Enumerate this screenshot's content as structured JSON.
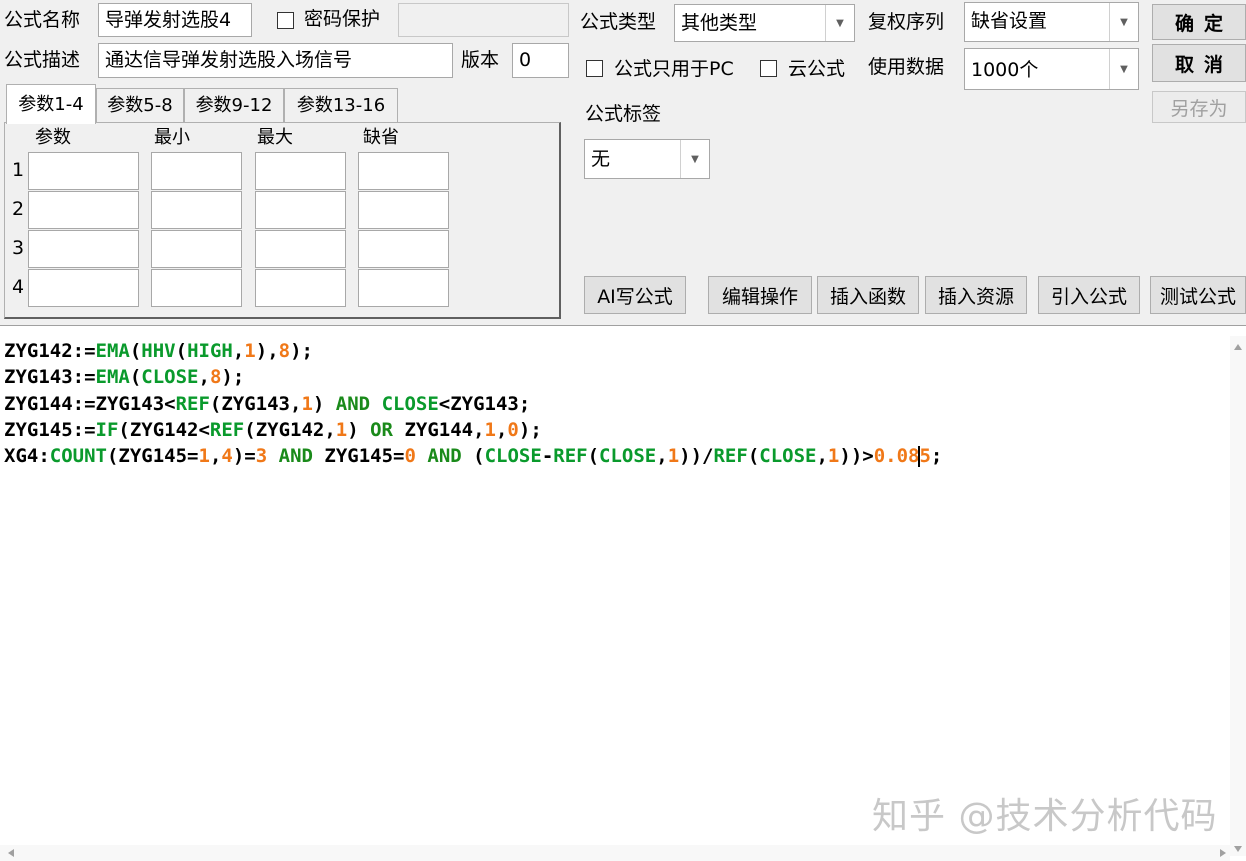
{
  "header": {
    "name_label": "公式名称",
    "name_value": "导弹发射选股4",
    "password_label": "密码保护",
    "password_value": "",
    "desc_label": "公式描述",
    "desc_value": "通达信导弹发射选股入场信号",
    "version_label": "版本",
    "version_value": "0",
    "type_label": "公式类型",
    "type_value": "其他类型",
    "rights_label": "复权序列",
    "rights_value": "缺省设置",
    "pc_only_label": "公式只用于PC",
    "cloud_label": "云公式",
    "data_label": "使用数据",
    "data_value": "1000个",
    "tag_label": "公式标签",
    "tag_value": "无"
  },
  "buttons": {
    "ok": "确定",
    "cancel": "取消",
    "save_as": "另存为",
    "ai": "AI写公式",
    "edit": "编辑操作",
    "insert_func": "插入函数",
    "insert_res": "插入资源",
    "import": "引入公式",
    "test": "测试公式"
  },
  "params": {
    "tabs": [
      "参数1-4",
      "参数5-8",
      "参数9-12",
      "参数13-16"
    ],
    "active_tab": 0,
    "columns": [
      "参数",
      "最小",
      "最大",
      "缺省"
    ],
    "rows": [
      "1",
      "2",
      "3",
      "4"
    ]
  },
  "editor": {
    "lines": [
      [
        {
          "t": "ZYG142:=",
          "c": ""
        },
        {
          "t": "EMA",
          "c": "fn"
        },
        {
          "t": "(",
          "c": ""
        },
        {
          "t": "HHV",
          "c": "fn"
        },
        {
          "t": "(",
          "c": ""
        },
        {
          "t": "HIGH",
          "c": "fn"
        },
        {
          "t": ",",
          "c": ""
        },
        {
          "t": "1",
          "c": "num"
        },
        {
          "t": "),",
          "c": ""
        },
        {
          "t": "8",
          "c": "num"
        },
        {
          "t": ");",
          "c": ""
        }
      ],
      [
        {
          "t": "ZYG143:=",
          "c": ""
        },
        {
          "t": "EMA",
          "c": "fn"
        },
        {
          "t": "(",
          "c": ""
        },
        {
          "t": "CLOSE",
          "c": "fn"
        },
        {
          "t": ",",
          "c": ""
        },
        {
          "t": "8",
          "c": "num"
        },
        {
          "t": ");",
          "c": ""
        }
      ],
      [
        {
          "t": "ZYG144:=ZYG143<",
          "c": ""
        },
        {
          "t": "REF",
          "c": "fn"
        },
        {
          "t": "(ZYG143,",
          "c": ""
        },
        {
          "t": "1",
          "c": "num"
        },
        {
          "t": ") ",
          "c": ""
        },
        {
          "t": "AND",
          "c": "kw"
        },
        {
          "t": " ",
          "c": ""
        },
        {
          "t": "CLOSE",
          "c": "fn"
        },
        {
          "t": "<ZYG143;",
          "c": ""
        }
      ],
      [
        {
          "t": "ZYG145:=",
          "c": ""
        },
        {
          "t": "IF",
          "c": "fn"
        },
        {
          "t": "(ZYG142<",
          "c": ""
        },
        {
          "t": "REF",
          "c": "fn"
        },
        {
          "t": "(ZYG142,",
          "c": ""
        },
        {
          "t": "1",
          "c": "num"
        },
        {
          "t": ") ",
          "c": ""
        },
        {
          "t": "OR",
          "c": "kw"
        },
        {
          "t": " ZYG144,",
          "c": ""
        },
        {
          "t": "1",
          "c": "num"
        },
        {
          "t": ",",
          "c": ""
        },
        {
          "t": "0",
          "c": "num"
        },
        {
          "t": ");",
          "c": ""
        }
      ],
      [
        {
          "t": "XG4:",
          "c": ""
        },
        {
          "t": "COUNT",
          "c": "fn"
        },
        {
          "t": "(ZYG145=",
          "c": ""
        },
        {
          "t": "1",
          "c": "num"
        },
        {
          "t": ",",
          "c": ""
        },
        {
          "t": "4",
          "c": "num"
        },
        {
          "t": ")=",
          "c": ""
        },
        {
          "t": "3",
          "c": "num"
        },
        {
          "t": " ",
          "c": ""
        },
        {
          "t": "AND",
          "c": "kw"
        },
        {
          "t": " ZYG145=",
          "c": ""
        },
        {
          "t": "0",
          "c": "num"
        },
        {
          "t": " ",
          "c": ""
        },
        {
          "t": "AND",
          "c": "kw"
        },
        {
          "t": " (",
          "c": ""
        },
        {
          "t": "CLOSE",
          "c": "fn"
        },
        {
          "t": "-",
          "c": ""
        },
        {
          "t": "REF",
          "c": "fn"
        },
        {
          "t": "(",
          "c": ""
        },
        {
          "t": "CLOSE",
          "c": "fn"
        },
        {
          "t": ",",
          "c": ""
        },
        {
          "t": "1",
          "c": "num"
        },
        {
          "t": "))/",
          "c": ""
        },
        {
          "t": "REF",
          "c": "fn"
        },
        {
          "t": "(",
          "c": ""
        },
        {
          "t": "CLOSE",
          "c": "fn"
        },
        {
          "t": ",",
          "c": ""
        },
        {
          "t": "1",
          "c": "num"
        },
        {
          "t": "))>",
          "c": ""
        },
        {
          "t": "0.08",
          "c": "num"
        },
        {
          "t": "|",
          "c": "caret"
        },
        {
          "t": "5",
          "c": "num"
        },
        {
          "t": ";",
          "c": ""
        }
      ]
    ]
  },
  "watermark": "知乎 @技术分析代码"
}
